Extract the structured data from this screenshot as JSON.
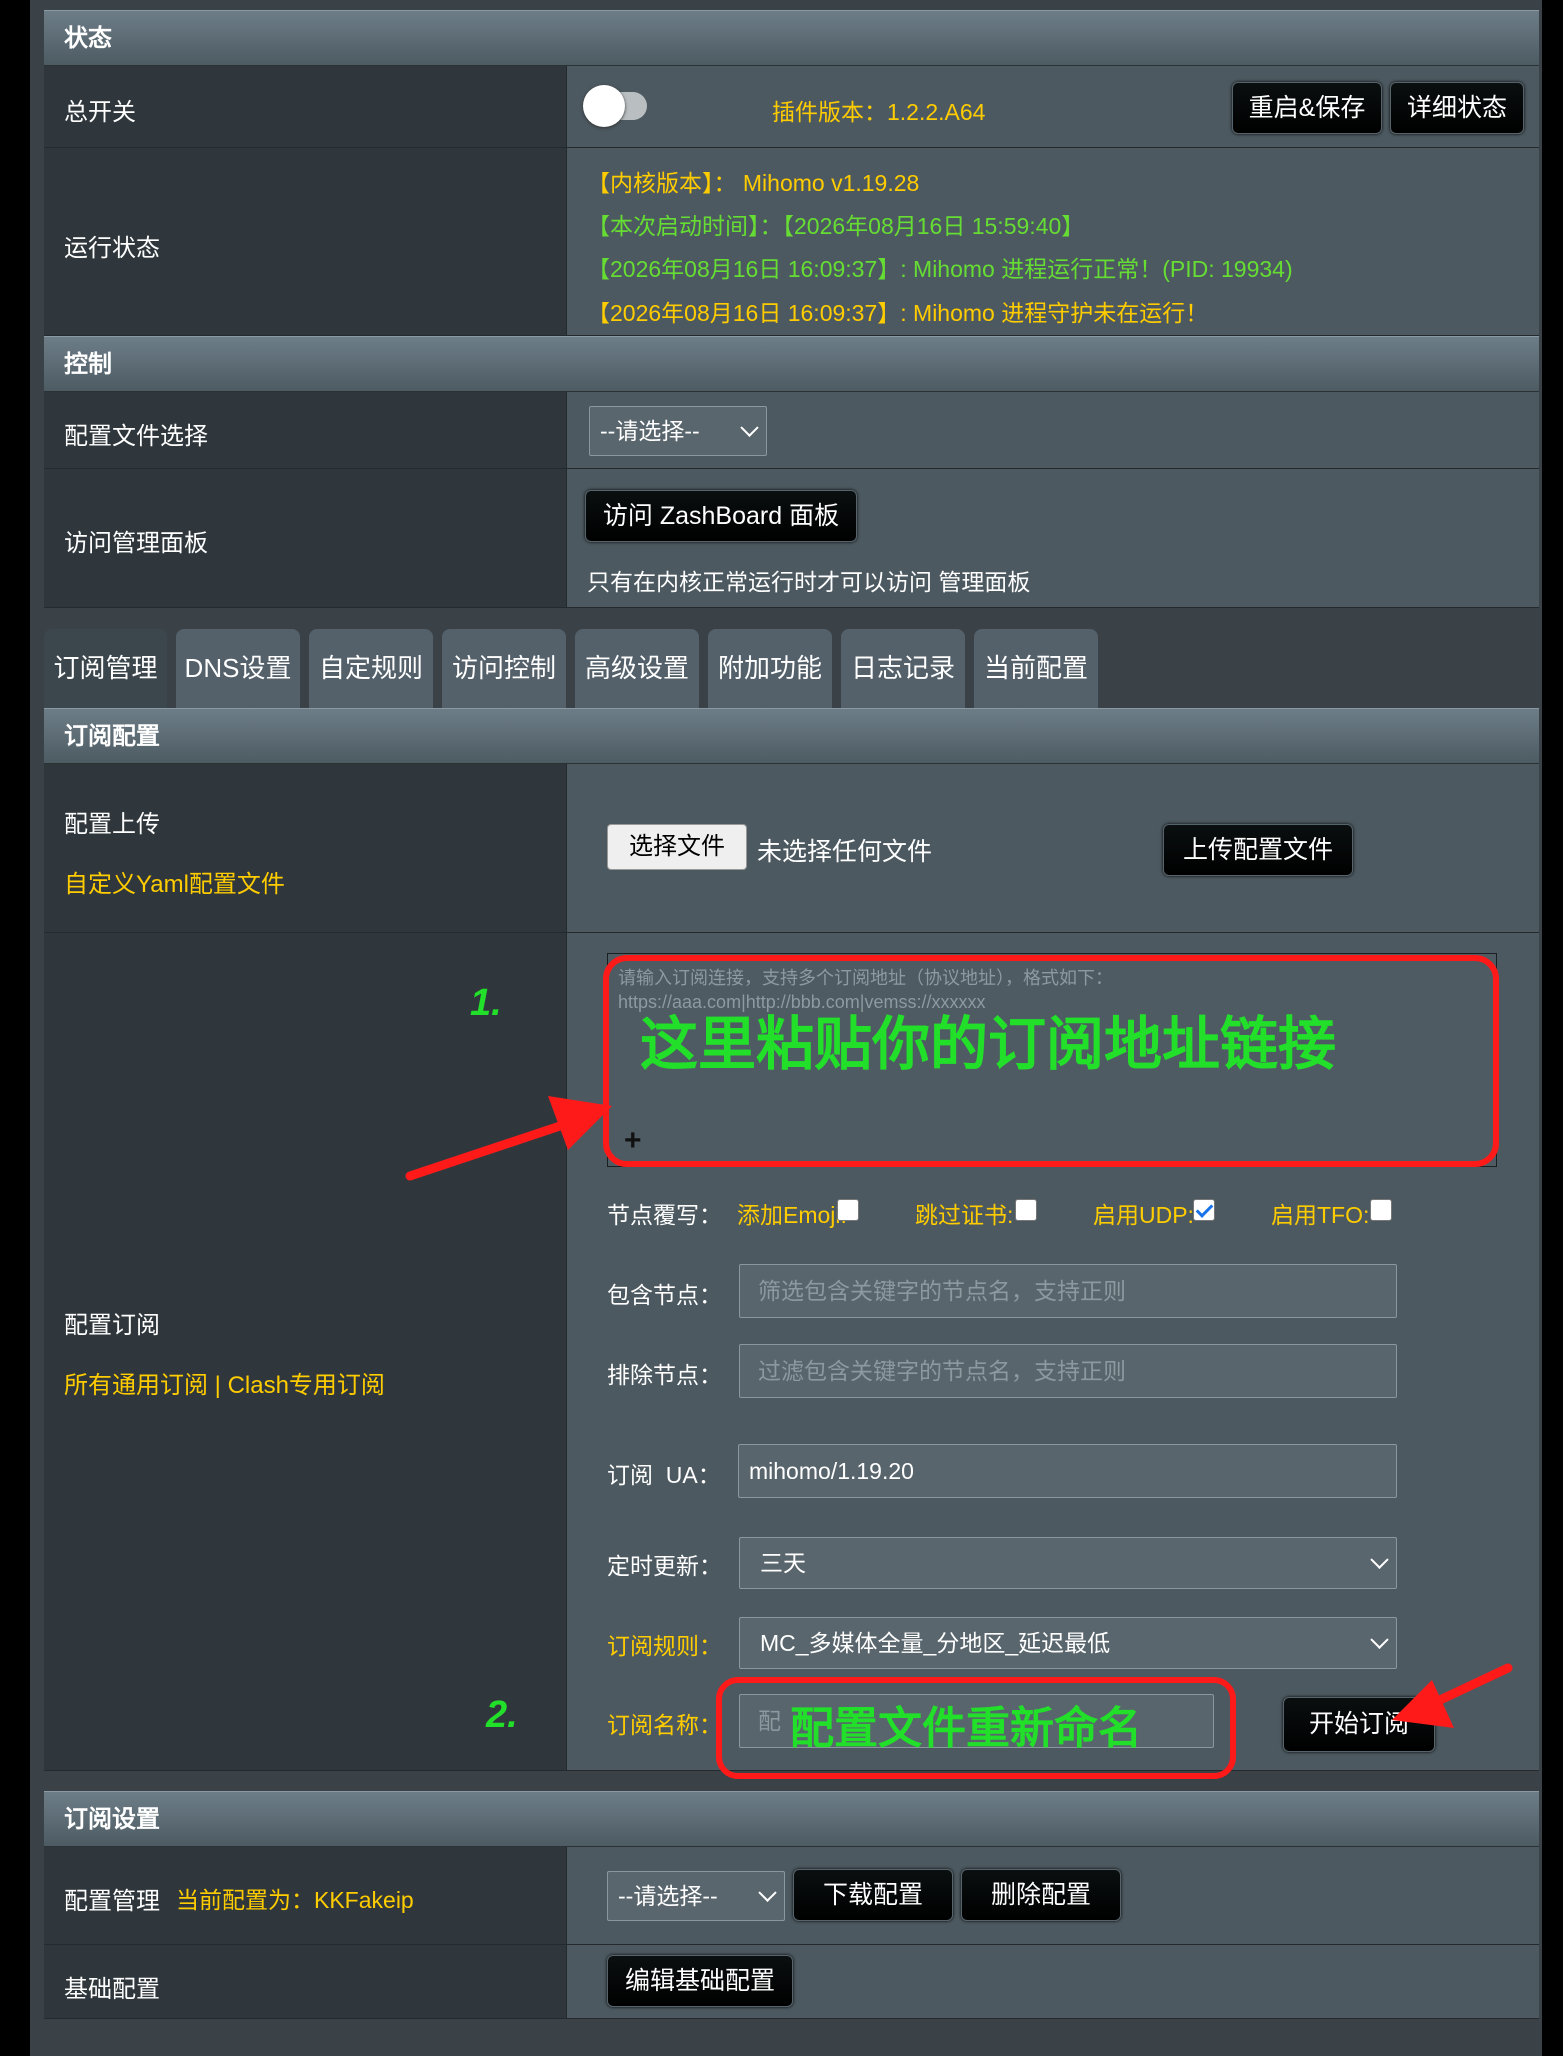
{
  "status": {
    "section_title": "状态",
    "master_switch_label": "总开关",
    "plugin_version": "插件版本：1.2.2.A64",
    "restart_save_button": "重启&保存",
    "detail_status_button": "详细状态",
    "run_status_label": "运行状态",
    "log_lines": [
      "【内核版本】： Mihomo v1.19.28",
      "【本次启动时间】：【2026年08月16日 15:59:40】",
      "【2026年08月16日 16:09:37】: Mihomo 进程运行正常！(PID: 19934)",
      "【2026年08月16日 16:09:37】: Mihomo 进程守护未在运行！"
    ]
  },
  "control": {
    "section_title": "控制",
    "config_file_select_label": "配置文件选择",
    "config_file_select_value": "--请选择--",
    "dashboard_label": "访问管理面板",
    "dashboard_button": "访问 ZashBoard 面板",
    "dashboard_note": "只有在内核正常运行时才可以访问 管理面板"
  },
  "tabs": [
    "订阅管理",
    "DNS设置",
    "自定规则",
    "访问控制",
    "高级设置",
    "附加功能",
    "日志记录",
    "当前配置"
  ],
  "subscription_config": {
    "section_title": "订阅配置",
    "upload_label": "配置上传",
    "upload_sublabel": "自定义Yaml配置文件",
    "choose_file_button": "选择文件",
    "no_file_text": "未选择任何文件",
    "upload_button": "上传配置文件",
    "subscribe_label": "配置订阅",
    "subscribe_sublabel": "所有通用订阅 | Clash专用订阅",
    "url_placeholder_line1": "请输入订阅连接，支持多个订阅地址（协议地址），格式如下：",
    "url_placeholder_line2": "https://aaa.com|http://bbb.com|vemss://xxxxxx",
    "node_override_label": "节点覆写：",
    "options": [
      {
        "label": "添加Emoji:",
        "checked": false
      },
      {
        "label": "跳过证书:",
        "checked": false
      },
      {
        "label": "启用UDP:",
        "checked": true
      },
      {
        "label": "启用TFO:",
        "checked": false
      }
    ],
    "include_nodes_label": "包含节点：",
    "include_nodes_placeholder": "筛选包含关键字的节点名，支持正则",
    "exclude_nodes_label": "排除节点：",
    "exclude_nodes_placeholder": "过滤包含关键字的节点名，支持正则",
    "ua_label": "订阅  UA：",
    "ua_value": "mihomo/1.19.20",
    "update_label": "定时更新：",
    "update_value": "三天",
    "rules_label": "订阅规则：",
    "rules_value": "MC_多媒体全量_分地区_延迟最低",
    "name_label": "订阅名称：",
    "name_placeholder": "配",
    "start_button": "开始订阅"
  },
  "subscription_settings": {
    "section_title": "订阅设置",
    "manage_label": "配置管理",
    "current_config": "当前配置为：KKFakeip",
    "select_value": "--请选择--",
    "download_button": "下载配置",
    "delete_button": "删除配置",
    "base_label": "基础配置",
    "edit_base_button": "编辑基础配置"
  },
  "annotations": {
    "step1": "1.",
    "step1_text": "这里粘贴你的订阅地址链接",
    "step2": "2.",
    "step2_text": "配置文件重新命名",
    "plus": "+"
  },
  "colors": {
    "accent_yellow": "#ffcc00",
    "log_green": "#66dd33",
    "annotation_green": "#22e02a",
    "annotation_red": "#ff1a1a"
  }
}
